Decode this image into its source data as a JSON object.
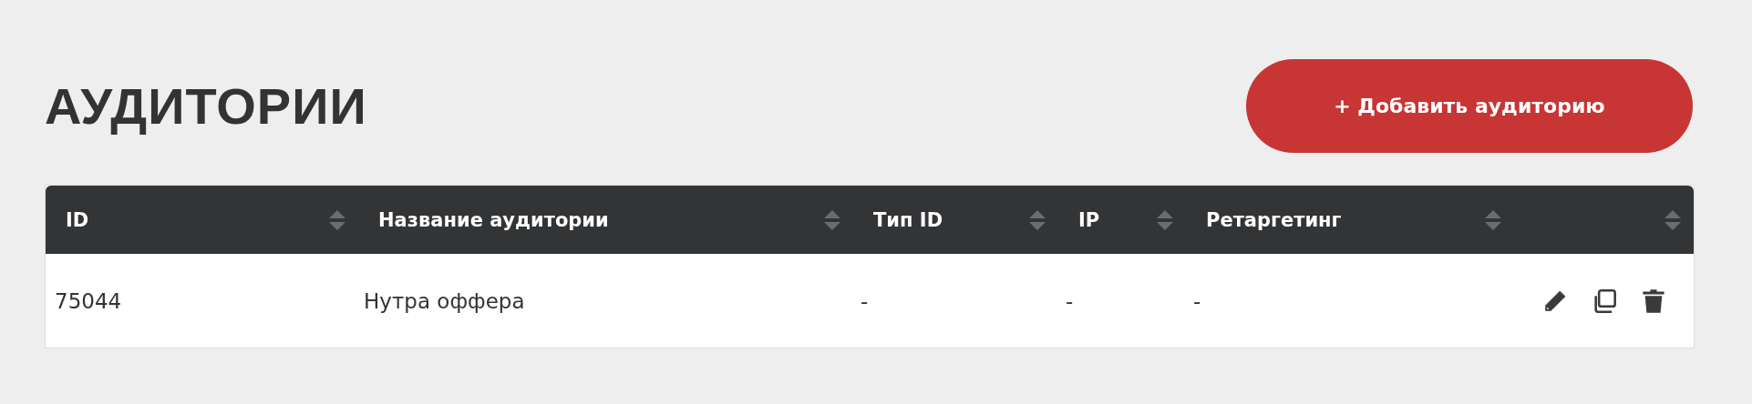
{
  "title": "АУДИТОРИИ",
  "add_button": {
    "label": "+ Добавить аудиторию"
  },
  "table": {
    "columns": [
      {
        "label": "ID"
      },
      {
        "label": "Название аудитории"
      },
      {
        "label": "Тип ID"
      },
      {
        "label": "IP"
      },
      {
        "label": "Ретаргетинг"
      }
    ],
    "rows": [
      {
        "cells": [
          "75044",
          "Нутра оффера",
          "-",
          "-",
          "-"
        ]
      }
    ]
  }
}
